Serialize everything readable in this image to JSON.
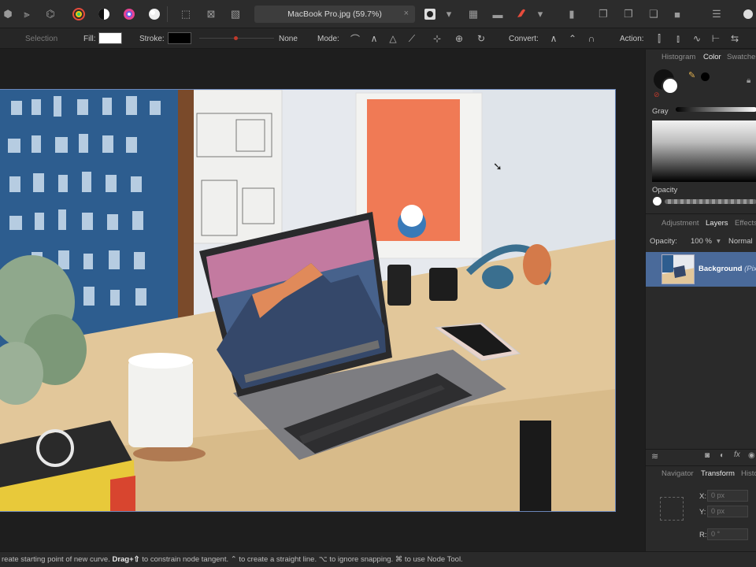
{
  "toolbar": {
    "document_tab": "MacBook Pro.jpg (59.7%)",
    "close_tab": "×",
    "dropdown_caret": "▾"
  },
  "context": {
    "tool_label": "Selection",
    "fill_label": "Fill:",
    "fill_color": "#ffffff",
    "stroke_label": "Stroke:",
    "stroke_color": "#000000",
    "stroke_width_value": "None",
    "mode_label": "Mode:",
    "convert_label": "Convert:",
    "action_label": "Action:"
  },
  "color_panel": {
    "tabs": [
      "Histogram",
      "Color",
      "Swatches"
    ],
    "active_tab": "Color",
    "gray_label": "Gray",
    "opacity_label": "Opacity"
  },
  "layers_panel": {
    "tabs": [
      "Adjustment",
      "Layers",
      "Effects"
    ],
    "active_tab": "Layers",
    "opacity_label": "Opacity:",
    "opacity_value": "100 %",
    "blend_mode": "Normal",
    "layer_name": "Background",
    "layer_type": "(Pixel)"
  },
  "transform_panel": {
    "tabs": [
      "Navigator",
      "Transform",
      "History"
    ],
    "active_tab": "Transform",
    "x_label": "X:",
    "x_value": "0 px",
    "y_label": "Y:",
    "y_value": "0 px",
    "r_label": "R:",
    "r_value": "0 °"
  },
  "status": {
    "part1": "reate starting point of new curve. ",
    "drag": "Drag+⇧",
    "part2": " to constrain node tangent. ⌃ to create a straight line. ⌥ to ignore snapping. ⌘ to use Node Tool."
  }
}
